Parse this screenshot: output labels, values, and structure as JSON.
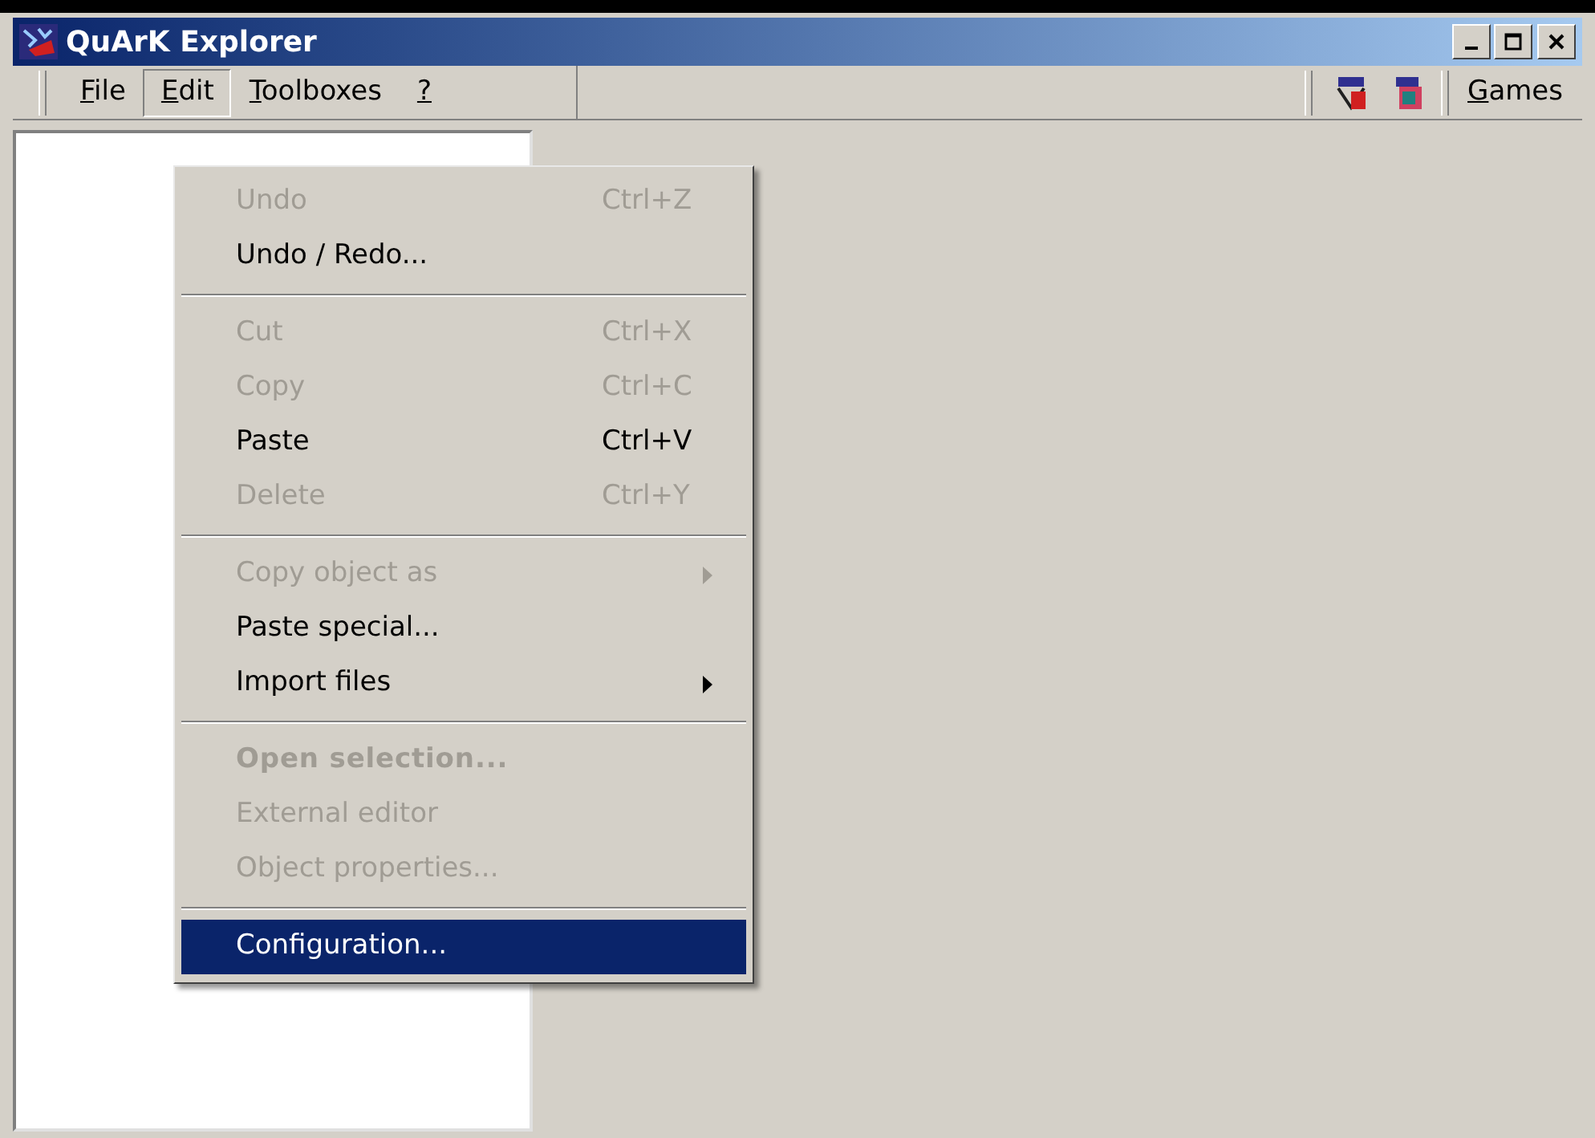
{
  "window": {
    "title": "QuArK Explorer"
  },
  "menubar": [
    {
      "label": "File",
      "mnemonic": true,
      "selected": false
    },
    {
      "label": "Edit",
      "mnemonic": true,
      "selected": true
    },
    {
      "label": "Toolboxes",
      "mnemonic": true,
      "selected": false
    },
    {
      "label": "?",
      "mnemonic": true,
      "selected": false
    }
  ],
  "games_button": {
    "label": "Games",
    "mnemonic": true
  },
  "menu": [
    {
      "kind": "item",
      "label": "Undo",
      "shortcut": "Ctrl+Z",
      "disabled": true,
      "bold": false,
      "submenu": false,
      "selected": false
    },
    {
      "kind": "item",
      "label": "Undo / Redo...",
      "disabled": false,
      "bold": false,
      "submenu": false,
      "selected": false
    },
    {
      "kind": "separator"
    },
    {
      "kind": "item",
      "label": "Cut",
      "shortcut": "Ctrl+X",
      "disabled": true,
      "bold": false,
      "submenu": false,
      "selected": false
    },
    {
      "kind": "item",
      "label": "Copy",
      "shortcut": "Ctrl+C",
      "disabled": true,
      "bold": false,
      "submenu": false,
      "selected": false
    },
    {
      "kind": "item",
      "label": "Paste",
      "shortcut": "Ctrl+V",
      "disabled": false,
      "bold": false,
      "submenu": false,
      "selected": false
    },
    {
      "kind": "item",
      "label": "Delete",
      "shortcut": "Ctrl+Y",
      "disabled": true,
      "bold": false,
      "submenu": false,
      "selected": false
    },
    {
      "kind": "separator"
    },
    {
      "kind": "item",
      "label": "Copy object as",
      "disabled": true,
      "bold": false,
      "submenu": true,
      "selected": false
    },
    {
      "kind": "item",
      "label": "Paste special...",
      "disabled": false,
      "bold": false,
      "submenu": false,
      "selected": false
    },
    {
      "kind": "item",
      "label": "Import files",
      "disabled": false,
      "bold": false,
      "submenu": true,
      "selected": false
    },
    {
      "kind": "separator"
    },
    {
      "kind": "item",
      "label": "Open selection...",
      "disabled": true,
      "bold": true,
      "submenu": false,
      "selected": false
    },
    {
      "kind": "item",
      "label": "External editor",
      "disabled": true,
      "bold": false,
      "submenu": false,
      "selected": false
    },
    {
      "kind": "item",
      "label": "Object properties...",
      "disabled": true,
      "bold": false,
      "submenu": false,
      "selected": false
    },
    {
      "kind": "separator"
    },
    {
      "kind": "item",
      "label": "Configuration...",
      "disabled": false,
      "bold": false,
      "submenu": false,
      "selected": true
    }
  ]
}
